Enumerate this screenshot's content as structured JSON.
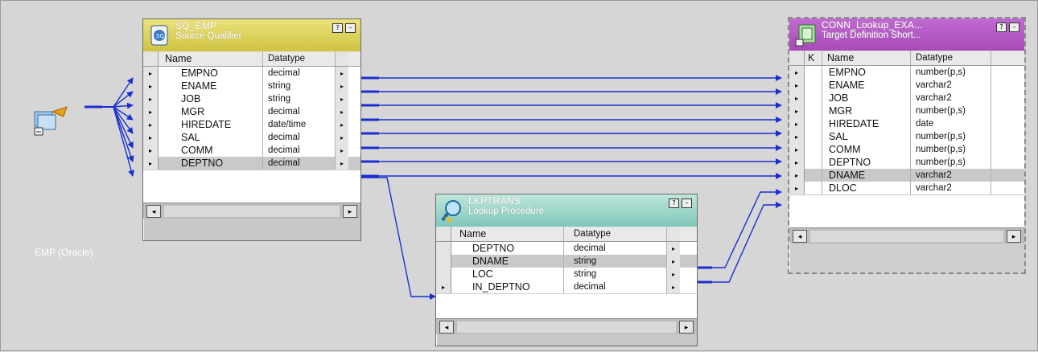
{
  "source": {
    "label": "EMP (Oracle)"
  },
  "sq": {
    "title": "SQ_EMP",
    "subtitle": "Source Qualifier",
    "headers": [
      "Name",
      "Datatype"
    ],
    "rows": [
      {
        "name": "EMPNO",
        "type": "decimal"
      },
      {
        "name": "ENAME",
        "type": "string"
      },
      {
        "name": "JOB",
        "type": "string"
      },
      {
        "name": "MGR",
        "type": "decimal"
      },
      {
        "name": "HIREDATE",
        "type": "date/time"
      },
      {
        "name": "SAL",
        "type": "decimal"
      },
      {
        "name": "COMM",
        "type": "decimal"
      },
      {
        "name": "DEPTNO",
        "type": "decimal"
      }
    ]
  },
  "lookup": {
    "title": "LKPTRANS",
    "subtitle": "Lookup Procedure",
    "headers": [
      "Name",
      "Datatype"
    ],
    "rows": [
      {
        "name": "DEPTNO",
        "type": "decimal"
      },
      {
        "name": "DNAME",
        "type": "string"
      },
      {
        "name": "LOC",
        "type": "string"
      },
      {
        "name": "IN_DEPTNO",
        "type": "decimal"
      }
    ]
  },
  "target": {
    "title": "CONN_Lookup_EXA...",
    "subtitle": "Target Definition Short...",
    "headers": [
      "K",
      "Name",
      "Datatype"
    ],
    "rows": [
      {
        "name": "EMPNO",
        "type": "number(p,s)"
      },
      {
        "name": "ENAME",
        "type": "varchar2"
      },
      {
        "name": "JOB",
        "type": "varchar2"
      },
      {
        "name": "MGR",
        "type": "number(p,s)"
      },
      {
        "name": "HIREDATE",
        "type": "date"
      },
      {
        "name": "SAL",
        "type": "number(p,s)"
      },
      {
        "name": "COMM",
        "type": "number(p,s)"
      },
      {
        "name": "DEPTNO",
        "type": "number(p,s)"
      },
      {
        "name": "DNAME",
        "type": "varchar2"
      },
      {
        "name": "DLOC",
        "type": "varchar2"
      }
    ]
  },
  "icons": {
    "source": "source-table-icon",
    "sq": "source-qualifier-icon",
    "lookup": "lookup-icon",
    "target": "target-definition-icon"
  },
  "colors": {
    "link": "#1a2fd0",
    "sq_header": "#d9cf55",
    "lookup_header": "#a3d8cc",
    "target_header": "#b255c2"
  }
}
